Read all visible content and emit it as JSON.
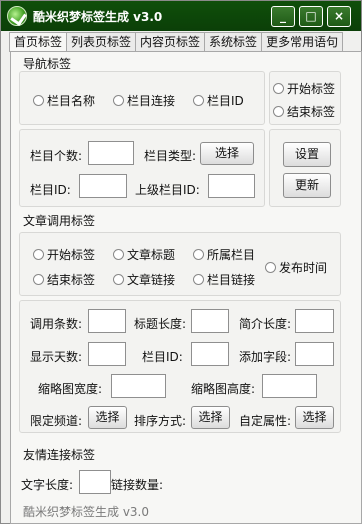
{
  "window": {
    "title": "酷米织梦标签生成 v3.0"
  },
  "titlebar_buttons": {
    "minimize": "_",
    "maximize": "□",
    "close": "×"
  },
  "tabs": [
    "首页标签",
    "列表页标签",
    "内容页标签",
    "系统标签",
    "更多常用语句"
  ],
  "nav": {
    "title": "导航标签",
    "radios": [
      "栏目名称",
      "栏目连接",
      "栏目ID"
    ],
    "side_radios": [
      "开始标签",
      "结束标签"
    ],
    "count_label": "栏目个数:",
    "type_label": "栏目类型:",
    "select_button": "选择",
    "id_label": "栏目ID:",
    "parent_id_label": "上级栏目ID:",
    "settings_button": "设置",
    "update_button": "更新"
  },
  "article": {
    "title": "文章调用标签",
    "radios_row1": [
      "开始标签",
      "文章标题",
      "所属栏目"
    ],
    "radios_row2": [
      "结束标签",
      "文章链接",
      "栏目链接"
    ],
    "publish_time": "发布时间",
    "call_count": "调用条数:",
    "title_length": "标题长度:",
    "summary_length": "简介长度:",
    "display_days": "显示天数:",
    "column_id": "栏目ID:",
    "add_field": "添加字段:",
    "thumb_width": "缩略图宽度:",
    "thumb_height": "缩略图高度:",
    "channel_limit": "限定频道:",
    "sort_by": "排序方式:",
    "custom_attr": "自定属性:",
    "select": "选择"
  },
  "links": {
    "title": "友情连接标签",
    "text_length": "文字长度:",
    "link_count": "链接数量:"
  },
  "footer": {
    "text": "酷米织梦标签生成 v3.0"
  }
}
